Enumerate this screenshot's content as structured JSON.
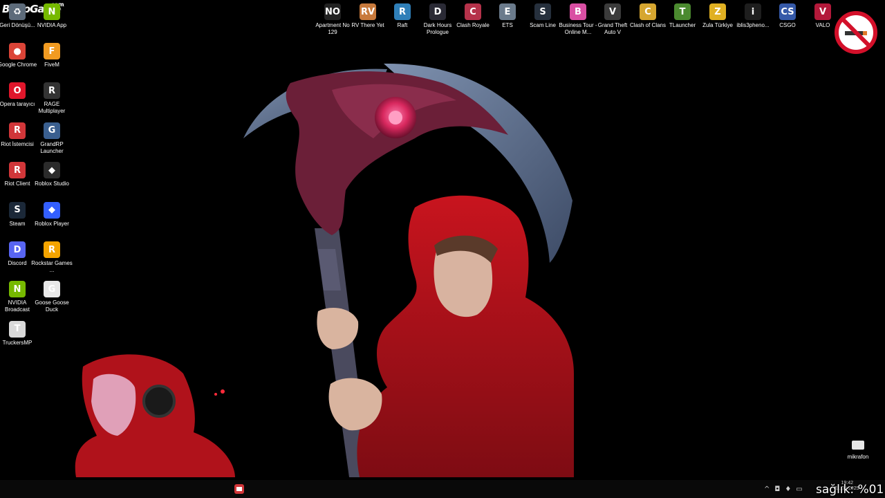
{
  "watermark": {
    "text": "ByNoGame",
    "suffix": ".com"
  },
  "top_icons": [
    {
      "label": "Geri Dönüşü...",
      "name": "recycle-bin-icon",
      "color": "#5d6b7a",
      "glyph": "♻"
    },
    {
      "label": "NVIDIA App",
      "name": "nvidia-app-icon",
      "color": "#76b900",
      "glyph": "N"
    },
    {
      "label": "Apartment No 129",
      "name": "apartment-no-129-icon",
      "color": "#222222",
      "glyph": "NO"
    },
    {
      "label": "RV There Yet",
      "name": "rv-there-yet-icon",
      "color": "#c87a3c",
      "glyph": "RV"
    },
    {
      "label": "Raft",
      "name": "raft-icon",
      "color": "#2f7fb8",
      "glyph": "R"
    },
    {
      "label": "Dark Hours Prologue",
      "name": "dark-hours-icon",
      "color": "#2a2a35",
      "glyph": "D"
    },
    {
      "label": "Clash Royale",
      "name": "clash-royale-icon",
      "color": "#b5324a",
      "glyph": "C"
    },
    {
      "label": "ETS",
      "name": "ets-icon",
      "color": "#6b7b8c",
      "glyph": "E"
    },
    {
      "label": "Scam Line",
      "name": "scam-line-icon",
      "color": "#26303d",
      "glyph": "S"
    },
    {
      "label": "Business Tour - Online M...",
      "name": "business-tour-icon",
      "color": "#d94fa3",
      "glyph": "B"
    },
    {
      "label": "Grand Theft Auto V",
      "name": "gta-v-icon",
      "color": "#3b3b3b",
      "glyph": "V"
    },
    {
      "label": "Clash of Clans",
      "name": "clash-of-clans-icon",
      "color": "#d6a630",
      "glyph": "C"
    },
    {
      "label": "TLauncher",
      "name": "tlauncher-icon",
      "color": "#4b8a2f",
      "glyph": "T"
    },
    {
      "label": "Zula Türkiye",
      "name": "zula-icon",
      "color": "#e0b022",
      "glyph": "Z"
    },
    {
      "label": "iblis3pheno...",
      "name": "iblis3pheno-icon",
      "color": "#1e1e1e",
      "glyph": "i"
    },
    {
      "label": "CSGO",
      "name": "csgo-icon",
      "color": "#3559a8",
      "glyph": "CS"
    },
    {
      "label": "VALO",
      "name": "valorant-icon",
      "color": "#b3193a",
      "glyph": "V"
    }
  ],
  "left_icons": [
    {
      "label": "Google Chrome",
      "name": "google-chrome-icon",
      "color": "#db4437",
      "glyph": "●"
    },
    {
      "label": "FiveM",
      "name": "fivem-icon",
      "color": "#f29b21",
      "glyph": "F"
    },
    {
      "label": "Opera tarayıcı",
      "name": "opera-icon",
      "color": "#e0162b",
      "glyph": "O"
    },
    {
      "label": "RAGE Multiplayer",
      "name": "rage-multiplayer-icon",
      "color": "#333333",
      "glyph": "R"
    },
    {
      "label": "Riot İstemcisi",
      "name": "riot-istemcisi-icon",
      "color": "#d13639",
      "glyph": "R"
    },
    {
      "label": "GrandRP Launcher",
      "name": "grandrp-launcher-icon",
      "color": "#3a5f8f",
      "glyph": "G"
    },
    {
      "label": "Riot Client",
      "name": "riot-client-icon",
      "color": "#d13639",
      "glyph": "R"
    },
    {
      "label": "Roblox Studio",
      "name": "roblox-studio-icon",
      "color": "#2b2b2b",
      "glyph": "◆"
    },
    {
      "label": "Steam",
      "name": "steam-icon",
      "color": "#1b2838",
      "glyph": "S"
    },
    {
      "label": "Roblox Player",
      "name": "roblox-player-icon",
      "color": "#335fff",
      "glyph": "◆"
    },
    {
      "label": "Discord",
      "name": "discord-icon",
      "color": "#5865f2",
      "glyph": "D"
    },
    {
      "label": "Rockstar Games ...",
      "name": "rockstar-games-icon",
      "color": "#f4a400",
      "glyph": "R"
    },
    {
      "label": "NVIDIA Broadcast",
      "name": "nvidia-broadcast-icon",
      "color": "#76b900",
      "glyph": "N"
    },
    {
      "label": "Goose Goose Duck",
      "name": "goose-goose-duck-icon",
      "color": "#e8e8e8",
      "glyph": "G"
    },
    {
      "label": "TruckersMP",
      "name": "truckersmp-icon",
      "color": "#d9d9d9",
      "glyph": "T"
    }
  ],
  "mic_icon": {
    "label": "mikrafon"
  },
  "overlay": {
    "health_text": "sağlık: %01"
  },
  "clock": {
    "time": "19:42",
    "date": "11.08.2025"
  },
  "colors": {
    "hoodie": "#b3121c",
    "scythe_blade": "#5b6d88",
    "scythe_head": "#7a2540",
    "eye": "#e0306a",
    "background": "#000000"
  }
}
